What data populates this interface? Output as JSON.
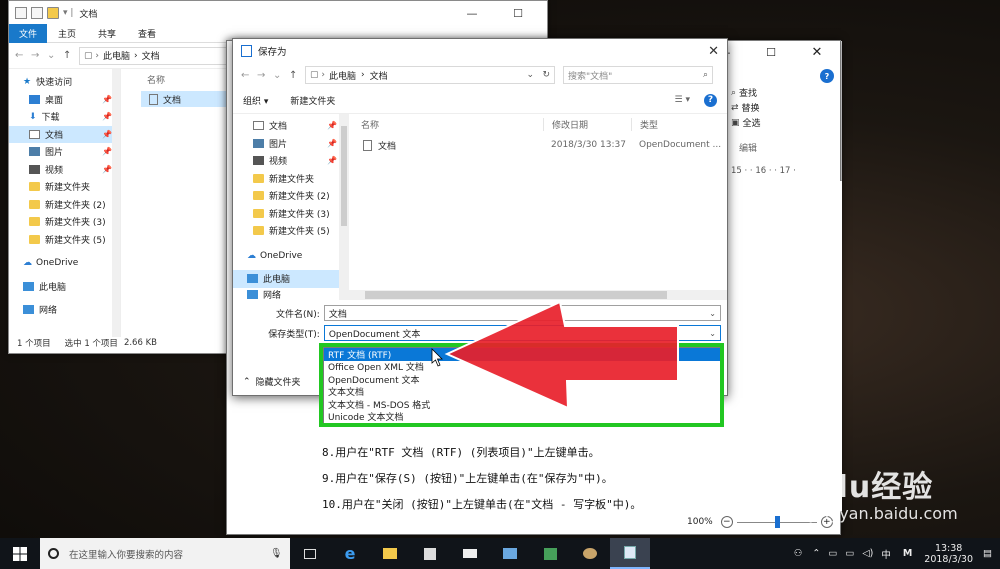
{
  "explorer": {
    "title": "文档",
    "tabs": [
      "文件",
      "主页",
      "共享",
      "查看"
    ],
    "path": [
      "此电脑",
      "文档"
    ],
    "column_name": "名称",
    "file_name": "文档",
    "nav": {
      "quick_access": "快速访问",
      "items": [
        "桌面",
        "下载",
        "文档",
        "图片",
        "视频",
        "新建文件夹",
        "新建文件夹 (2)",
        "新建文件夹 (3)",
        "新建文件夹 (5)"
      ],
      "onedrive": "OneDrive",
      "this_pc": "此电脑",
      "network": "网络"
    },
    "status": {
      "count": "1 个项目",
      "selected": "选中 1 个项目",
      "size": "2.66 KB"
    }
  },
  "wordpad": {
    "ribbon_items": [
      "查找",
      "替换",
      "全选"
    ],
    "ribbon_group": "编辑",
    "ruler": "15 · · 16 · · 17 ·",
    "doc_lines": [
      "8.用户在\"RTF 文档 (RTF) (列表项目)\"上左键单击。",
      "9.用户在\"保存(S) (按钮)\"上左键单击(在\"保存为\"中)。",
      "10.用户在\"关闭 (按钮)\"上左键单击(在\"文档 - 写字板\"中)。"
    ],
    "zoom": "100%"
  },
  "saveas": {
    "title": "保存为",
    "path": [
      "此电脑",
      "文档"
    ],
    "search_placeholder": "搜索\"文档\"",
    "organize": "组织",
    "new_folder": "新建文件夹",
    "columns": {
      "name": "名称",
      "date": "修改日期",
      "type": "类型"
    },
    "file": {
      "name": "文档",
      "date": "2018/3/30 13:37",
      "type": "OpenDocument ..."
    },
    "nav_items": [
      "文档",
      "图片",
      "视频",
      "新建文件夹",
      "新建文件夹 (2)",
      "新建文件夹 (3)",
      "新建文件夹 (5)"
    ],
    "onedrive": "OneDrive",
    "this_pc": "此电脑",
    "network": "网络",
    "filename_label": "文件名(N):",
    "filename_value": "文档",
    "filetype_label": "保存类型(T):",
    "filetype_value": "OpenDocument 文本",
    "hide_folders": "隐藏文件夹",
    "filetype_options": [
      "RTF 文档 (RTF)",
      "Office Open XML 文档",
      "OpenDocument 文本",
      "文本文档",
      "文本文档 - MS-DOS 格式",
      "Unicode 文本文档"
    ]
  },
  "taskbar": {
    "search_placeholder": "在这里输入你要搜索的内容",
    "time": "13:38",
    "date": "2018/3/30",
    "ime": "中",
    "ime2": "M"
  },
  "watermark": {
    "brand": "Baidu经验",
    "site": "jingyan.baidu.com"
  },
  "colors": {
    "highlight": "#0a78d7",
    "annotation_green": "#22c722",
    "annotation_red": "#e8202a"
  }
}
